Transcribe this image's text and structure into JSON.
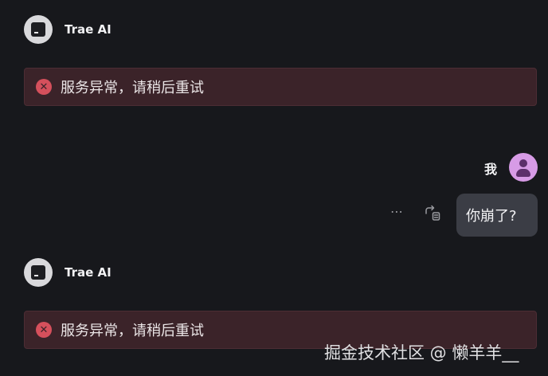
{
  "conversation": [
    {
      "role": "assistant",
      "name": "Trae AI",
      "error": "服务异常，请稍后重试"
    },
    {
      "role": "user",
      "name": "我",
      "message": "你崩了?",
      "actions": {
        "more": "⋯"
      }
    },
    {
      "role": "assistant",
      "name": "Trae AI",
      "error": "服务异常，请稍后重试"
    }
  ],
  "watermark": "掘金技术社区 @ 懒羊羊__",
  "colors": {
    "background": "#17181c",
    "error_bg": "#3b2329",
    "error_icon": "#d5505c",
    "user_bubble": "#3b3d45",
    "user_avatar": "#d79be6"
  },
  "icons": {
    "assistant_avatar": "terminal-icon",
    "error": "error-x-icon",
    "user_avatar": "person-icon",
    "more": "more-horizontal-icon",
    "copy": "copy-to-input-icon"
  }
}
